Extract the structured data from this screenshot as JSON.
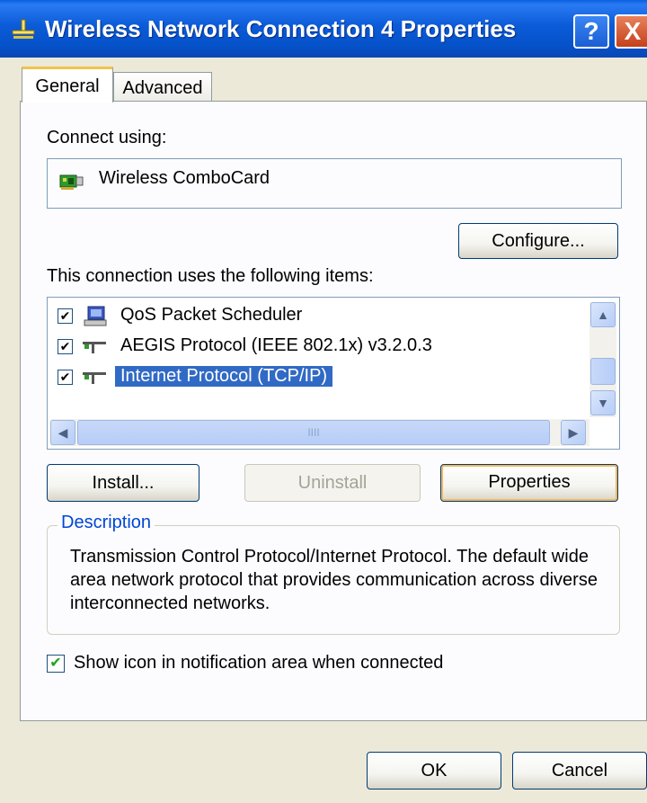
{
  "window": {
    "title": "Wireless Network Connection 4 Properties",
    "help_glyph": "?",
    "close_glyph": "X"
  },
  "tabs": [
    {
      "label": "General",
      "active": true
    },
    {
      "label": "Advanced",
      "active": false
    }
  ],
  "connect_using": {
    "label": "Connect using:",
    "device": "Wireless ComboCard",
    "configure_button": "Configure..."
  },
  "items_section": {
    "label": "This connection uses the following items:",
    "items": [
      {
        "label": "QoS Packet Scheduler",
        "checked": true,
        "icon": "scheduler-icon",
        "selected": false
      },
      {
        "label": "AEGIS Protocol (IEEE 802.1x) v3.2.0.3",
        "checked": true,
        "icon": "protocol-icon",
        "selected": false
      },
      {
        "label": "Internet Protocol (TCP/IP)",
        "checked": true,
        "icon": "protocol-icon",
        "selected": true
      }
    ]
  },
  "scrollbars": {
    "up": "▲",
    "down": "▼",
    "left": "◀",
    "right": "▶",
    "grip": "IIII"
  },
  "actions": {
    "install": "Install...",
    "uninstall": "Uninstall",
    "properties": "Properties"
  },
  "description": {
    "title": "Description",
    "text": "Transmission Control Protocol/Internet Protocol. The default wide area network protocol that provides communication across diverse interconnected networks."
  },
  "notify": {
    "label": "Show icon in notification area when connected",
    "checked": true,
    "check_glyph": "✔"
  },
  "check_glyph": "✔",
  "footer": {
    "ok": "OK",
    "cancel": "Cancel"
  },
  "colors": {
    "titlebar": "#0b5bd8",
    "selection": "#316ac5",
    "group_title": "#0046d5",
    "focus_border": "#f5b65a"
  }
}
